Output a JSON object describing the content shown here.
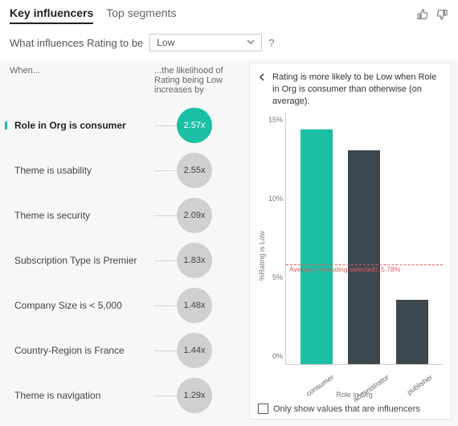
{
  "header": {
    "tabs": {
      "key_influencers": "Key influencers",
      "top_segments": "Top segments"
    }
  },
  "question": {
    "prefix": "What influences Rating to be",
    "selected": "Low",
    "help": "?"
  },
  "left": {
    "when_label": "When...",
    "likelihood_label": "...the likelihood of Rating being Low increases by",
    "influencers": [
      {
        "label": "Role in Org is consumer",
        "value": "2.57x",
        "selected": true
      },
      {
        "label": "Theme is usability",
        "value": "2.55x",
        "selected": false
      },
      {
        "label": "Theme is security",
        "value": "2.09x",
        "selected": false
      },
      {
        "label": "Subscription Type is Premier",
        "value": "1.83x",
        "selected": false
      },
      {
        "label": "Company Size is < 5,000",
        "value": "1.48x",
        "selected": false
      },
      {
        "label": "Country-Region is France",
        "value": "1.44x",
        "selected": false
      },
      {
        "label": "Theme is navigation",
        "value": "1.29x",
        "selected": false
      }
    ]
  },
  "right": {
    "summary": "Rating is more likely to be Low when Role in Org is consumer than otherwise (on average).",
    "avg_label": "Average (excluding selected): 5.78%",
    "checkbox_label": "Only show values that are influencers"
  },
  "chart_data": {
    "type": "bar",
    "title": "",
    "xlabel": "Role in Org",
    "ylabel": "%Rating is Low",
    "ylim": [
      0,
      16
    ],
    "yticks": [
      0,
      5,
      10,
      15
    ],
    "categories": [
      "consumer",
      "administrator",
      "publisher"
    ],
    "values": [
      14.9,
      13.6,
      4.1
    ],
    "selected_index": 0,
    "average_excluding_selected": 5.78
  }
}
